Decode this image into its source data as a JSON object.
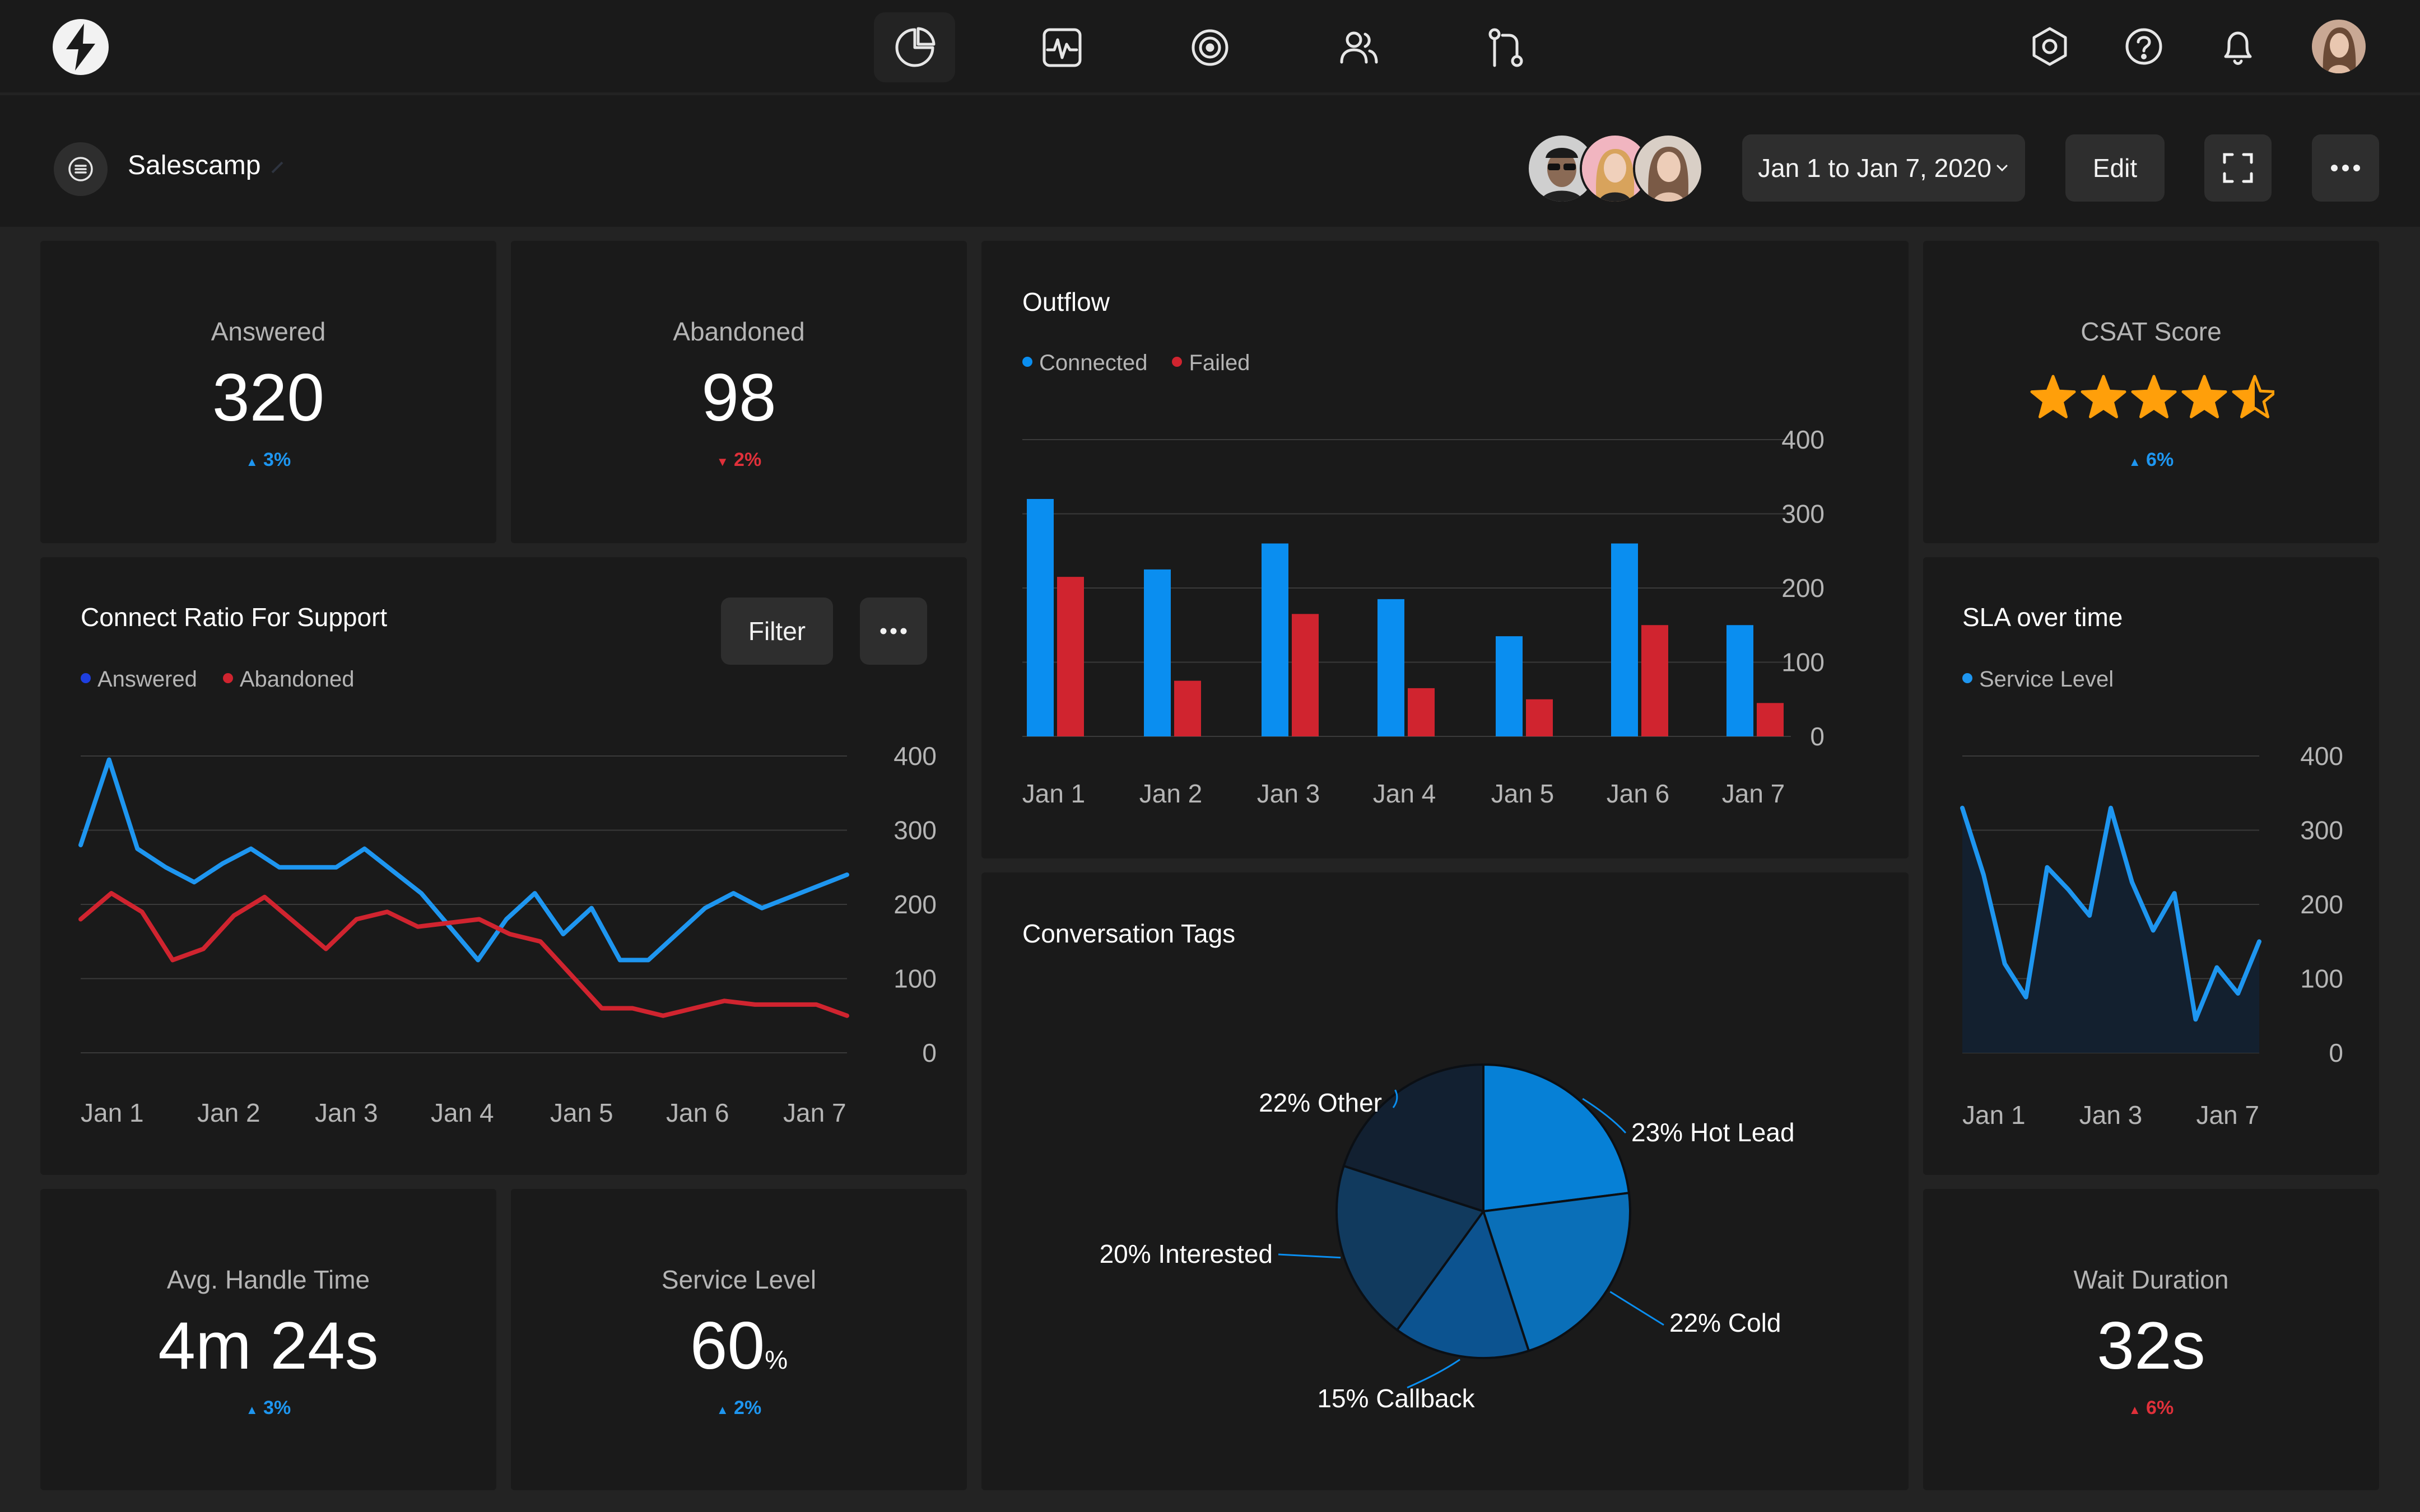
{
  "app": {
    "name": "Salescamp"
  },
  "nav": {
    "items": [
      {
        "icon": "pie-chart-icon",
        "active": true
      },
      {
        "icon": "activity-icon",
        "active": false
      },
      {
        "icon": "target-icon",
        "active": false
      },
      {
        "icon": "users-icon",
        "active": false
      },
      {
        "icon": "git-compare-icon",
        "active": false
      }
    ],
    "right": [
      "settings-icon",
      "help-icon",
      "bell-icon",
      "avatar"
    ]
  },
  "toolbar": {
    "date_range": "Jan 1 to Jan 7, 2020",
    "edit_label": "Edit"
  },
  "colors": {
    "blue": "#0a8ef0",
    "red": "#d0242f",
    "bg": "#232323",
    "card": "#1a1a1a",
    "star": "#ff9f0a"
  },
  "kpis": {
    "answered": {
      "label": "Answered",
      "value": "320",
      "delta": "3%",
      "trend": "up"
    },
    "abandoned": {
      "label": "Abandoned",
      "value": "98",
      "delta": "2%",
      "trend": "down"
    },
    "csat": {
      "label": "CSAT Score",
      "rating": 4.5,
      "max": 5,
      "delta": "6%",
      "trend": "up"
    },
    "aht": {
      "label": "Avg. Handle Time",
      "value": "4m 24s",
      "delta": "3%",
      "trend": "up"
    },
    "service_level": {
      "label": "Service Level",
      "value": "60",
      "unit": "%",
      "delta": "2%",
      "trend": "up"
    },
    "wait": {
      "label": "Wait Duration",
      "value": "32s",
      "delta": "6%",
      "trend": "down"
    }
  },
  "connect_ratio": {
    "title": "Connect Ratio For Support",
    "filter_label": "Filter",
    "legend": [
      {
        "name": "Answered",
        "color": "#1e3fe0"
      },
      {
        "name": "Abandoned",
        "color": "#d0242f"
      }
    ]
  },
  "outflow": {
    "title": "Outflow"
  },
  "tags": {
    "title": "Conversation Tags"
  },
  "sla": {
    "title": "SLA over time"
  },
  "chart_data": [
    {
      "id": "connect_ratio",
      "type": "line",
      "title": "Connect Ratio For Support",
      "x_ticks": [
        "Jan 1",
        "Jan 2",
        "Jan 3",
        "Jan 4",
        "Jan 5",
        "Jan 6",
        "Jan 7"
      ],
      "y_ticks": [
        0,
        100,
        200,
        300,
        400
      ],
      "ylim": [
        0,
        400
      ],
      "grid": true,
      "legend": "top-left",
      "series": [
        {
          "name": "Answered",
          "color": "#1e96f0",
          "values": [
            280,
            395,
            275,
            250,
            230,
            255,
            275,
            250,
            250,
            250,
            275,
            245,
            215,
            170,
            125,
            180,
            215,
            160,
            195,
            125,
            125,
            160,
            195,
            215,
            195,
            210,
            225,
            240
          ]
        },
        {
          "name": "Abandoned",
          "color": "#d0242f",
          "values": [
            180,
            215,
            190,
            125,
            140,
            185,
            210,
            175,
            140,
            180,
            190,
            170,
            175,
            180,
            160,
            150,
            105,
            60,
            60,
            50,
            60,
            70,
            65,
            65,
            65,
            50
          ]
        }
      ]
    },
    {
      "id": "outflow",
      "type": "bar",
      "title": "Outflow",
      "categories": [
        "Jan 1",
        "Jan 2",
        "Jan 3",
        "Jan 4",
        "Jan 5",
        "Jan 6",
        "Jan 7"
      ],
      "y_ticks": [
        0,
        100,
        200,
        300,
        400
      ],
      "ylim": [
        0,
        400
      ],
      "grid": true,
      "legend": "top-left",
      "series": [
        {
          "name": "Connected",
          "color": "#0a8ef0",
          "values": [
            320,
            225,
            260,
            185,
            135,
            260,
            150
          ]
        },
        {
          "name": "Failed",
          "color": "#d0242f",
          "values": [
            215,
            75,
            165,
            65,
            50,
            150,
            45
          ]
        }
      ]
    },
    {
      "id": "tags",
      "type": "pie",
      "title": "Conversation Tags",
      "slices": [
        {
          "label": "23% Hot Lead",
          "value": 23,
          "color": "#0680d6"
        },
        {
          "label": "22% Cold",
          "value": 22,
          "color": "#0a6fb8"
        },
        {
          "label": "15% Callback",
          "value": 15,
          "color": "#0c5390"
        },
        {
          "label": "20% Interested",
          "value": 20,
          "color": "#113a5e"
        },
        {
          "label": "22% Other",
          "value": 20,
          "color": "#122031"
        }
      ]
    },
    {
      "id": "sla",
      "type": "area",
      "title": "SLA over time",
      "x_ticks": [
        "Jan 1",
        "Jan 3",
        "Jan 7"
      ],
      "y_ticks": [
        0,
        100,
        200,
        300,
        400
      ],
      "ylim": [
        0,
        400
      ],
      "grid": true,
      "legend": "top-left",
      "series": [
        {
          "name": "Service Level",
          "color": "#1e96f0",
          "values": [
            330,
            240,
            120,
            75,
            250,
            220,
            185,
            330,
            230,
            165,
            215,
            45,
            115,
            80,
            150
          ]
        }
      ]
    }
  ]
}
